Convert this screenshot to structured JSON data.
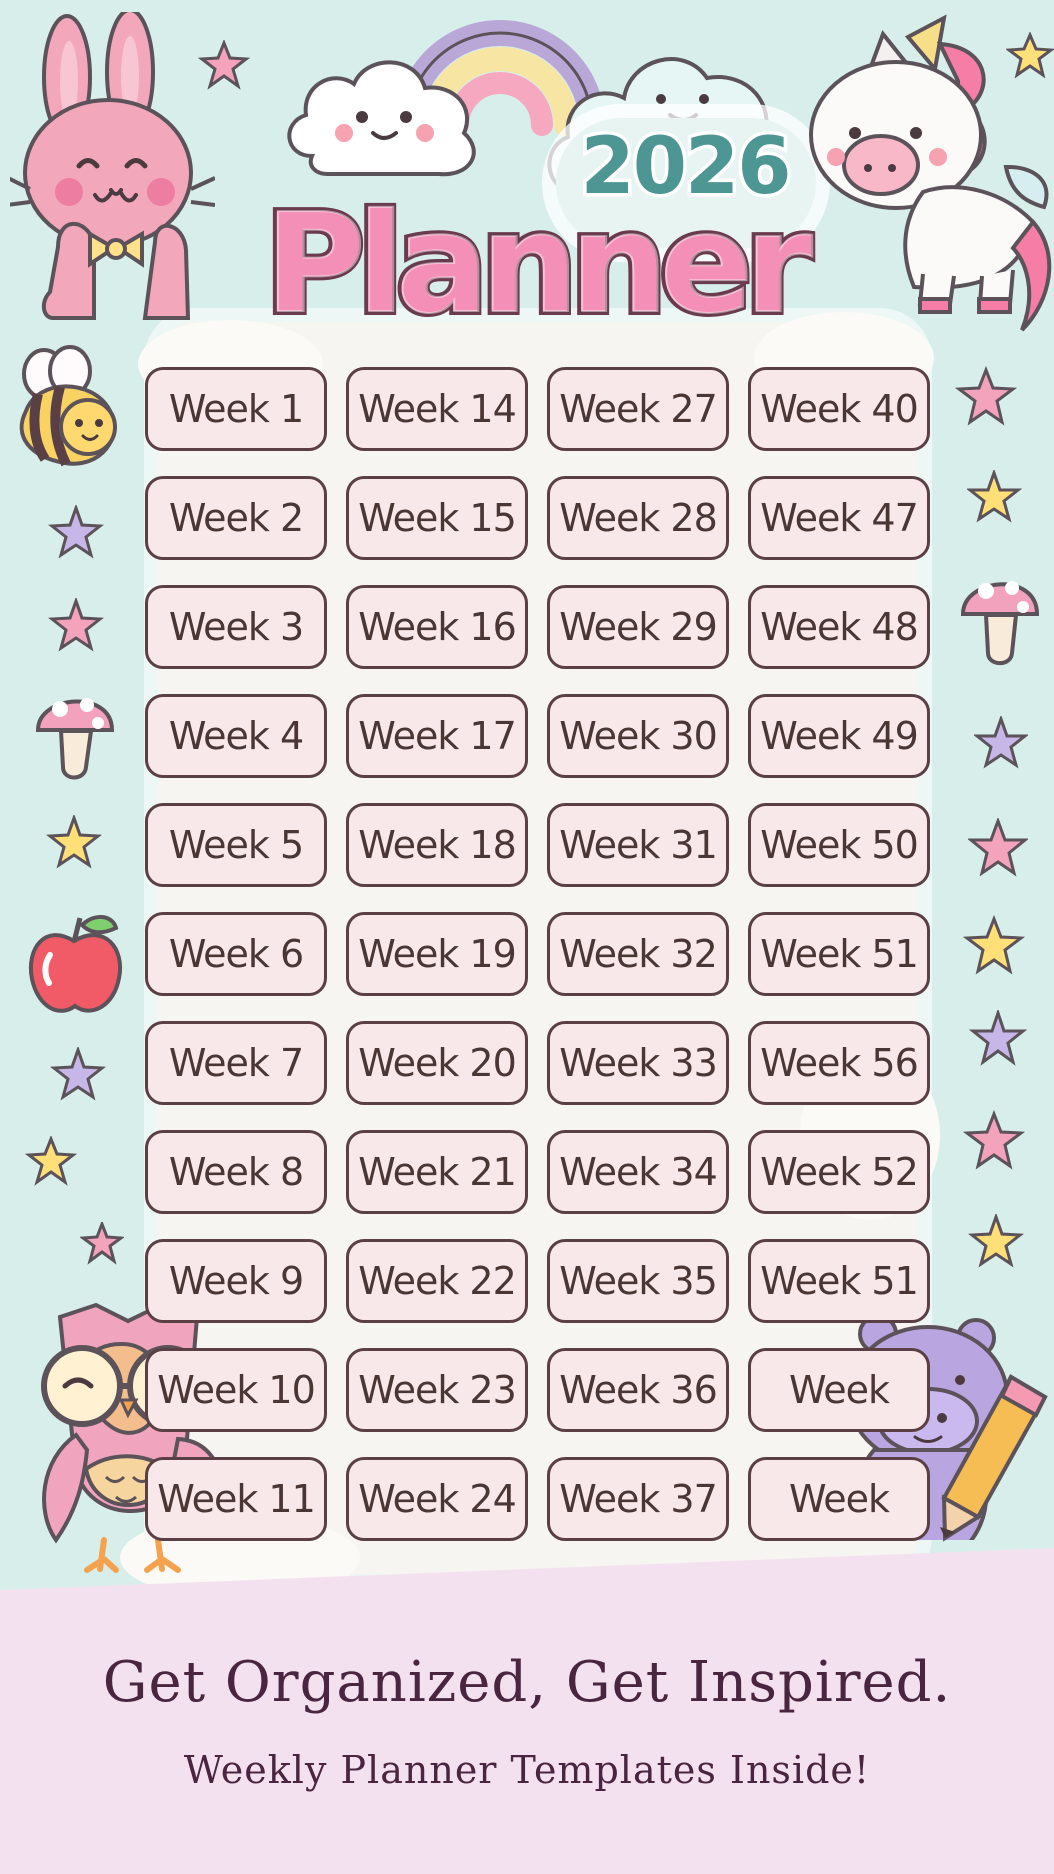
{
  "header": {
    "year": "2026",
    "title": "Planner"
  },
  "weeks": [
    [
      "Week 1",
      "Week 14",
      "Week 27",
      "Week 40"
    ],
    [
      "Week 2",
      "Week 15",
      "Week 28",
      "Week 47"
    ],
    [
      "Week 3",
      "Week 16",
      "Week 29",
      "Week 48"
    ],
    [
      "Week 4",
      "Week 17",
      "Week 30",
      "Week 49"
    ],
    [
      "Week 5",
      "Week 18",
      "Week 31",
      "Week 50"
    ],
    [
      "Week 6",
      "Week 19",
      "Week 32",
      "Week 51"
    ],
    [
      "Week 7",
      "Week 20",
      "Week 33",
      "Week 56"
    ],
    [
      "Week 8",
      "Week 21",
      "Week 34",
      "Week 52"
    ],
    [
      "Week 9",
      "Week 22",
      "Week 35",
      "Week 51"
    ],
    [
      "Week 10",
      "Week 23",
      "Week 36",
      "Week"
    ],
    [
      "Week 11",
      "Week 24",
      "Week 37",
      "Week"
    ]
  ],
  "footer": {
    "tagline": "Get Organized, Get Inspired.",
    "subtitle": "Weekly Planner Templates Inside!"
  },
  "colors": {
    "background": "#d7eeea",
    "title_pink": "#f48fb7",
    "year_teal": "#4e9693",
    "button_fill": "#f9e8ea",
    "footer": "#f4e1ef",
    "text_dark": "#493635"
  },
  "decorations": {
    "icons": [
      "bunny-icon",
      "cloud-icon",
      "rainbow-icon",
      "unicorn-icon",
      "bee-icon",
      "mushroom-icon",
      "apple-icon",
      "owl-icon",
      "hippo-icon",
      "pencil-icon",
      "star-icon"
    ]
  }
}
